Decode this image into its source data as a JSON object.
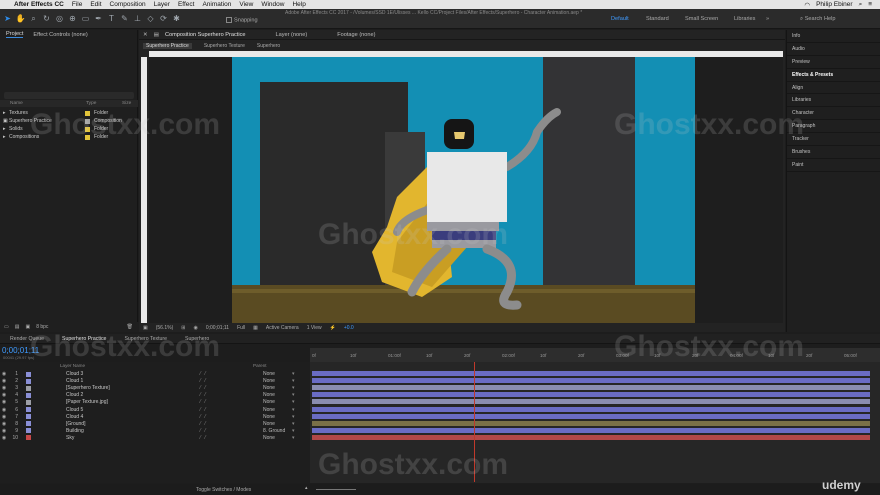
{
  "menubar": {
    "app": "After Effects CC",
    "items": [
      "File",
      "Edit",
      "Composition",
      "Layer",
      "Effect",
      "Animation",
      "View",
      "Window",
      "Help"
    ],
    "user": "Philip Ebiner"
  },
  "toolbar": {
    "title": "Adobe After Effects CC 2017 - /Volumes/SSD 1E/Ulisses ... Kello CC/Project Files/After Effects/Superhero - Character Animation.aep *",
    "snapping_label": "Snapping",
    "workspaces": [
      "Default",
      "Standard",
      "Small Screen",
      "Libraries"
    ],
    "active_workspace": "Default",
    "search_placeholder": "Search Help"
  },
  "project": {
    "tabs": [
      "Project",
      "Effect Controls (none)"
    ],
    "columns": [
      "Name",
      "Type",
      "Size"
    ],
    "items": [
      {
        "name": "Textures",
        "type": "Folder"
      },
      {
        "name": "Superhero Practice",
        "type": "Composition"
      },
      {
        "name": "Solids",
        "type": "Folder"
      },
      {
        "name": "Compositions",
        "type": "Folder"
      }
    ],
    "bpc": "8 bpc"
  },
  "comp": {
    "tabs": [
      "Composition Superhero Practice",
      "Layer (none)",
      "Footage (none)"
    ],
    "subtabs": [
      "Superhero Practice",
      "Superhero Texture",
      "Superhero"
    ],
    "footer": {
      "zoom": "(56.1%)",
      "timecode": "0;00;01;11",
      "resolution": "Full",
      "camera": "Active Camera",
      "views": "1 View",
      "exposure": "+0.0"
    },
    "colors": {
      "sky": "#138fb4",
      "building": "#2b2b2b",
      "ground": "#5a4b22",
      "cape": "#e2b62e",
      "shirt": "#e8e8e8",
      "stripe": "#3a3d7d",
      "limb": "#8c8c8c"
    }
  },
  "right_panels": [
    "Info",
    "Audio",
    "Preview",
    "Effects & Presets",
    "Align",
    "Libraries",
    "Character",
    "Paragraph",
    "Tracker",
    "Brushes",
    "Paint"
  ],
  "timeline": {
    "render_queue": "Render Queue",
    "tabs": [
      "Superhero Practice",
      "Superhero Texture",
      "Superhero"
    ],
    "timecode": "0;00;01;11",
    "fps": "00041 (29.97 fps)",
    "columns": {
      "name": "Layer Name",
      "parent": "Parent"
    },
    "layers": [
      {
        "num": "1",
        "name": "Cloud 3",
        "parent": "None",
        "color": "#8a8fd6"
      },
      {
        "num": "2",
        "name": "Cloud 1",
        "parent": "None",
        "color": "#8a8fd6"
      },
      {
        "num": "3",
        "name": "[Superhero Texture]",
        "parent": "None",
        "color": "#9c9ea6"
      },
      {
        "num": "4",
        "name": "Cloud 2",
        "parent": "None",
        "color": "#8a8fd6"
      },
      {
        "num": "5",
        "name": "[Paper Texture.jpg]",
        "parent": "None",
        "color": "#9c9ea6"
      },
      {
        "num": "6",
        "name": "Cloud 5",
        "parent": "None",
        "color": "#8a8fd6"
      },
      {
        "num": "7",
        "name": "Cloud 4",
        "parent": "None",
        "color": "#8a8fd6"
      },
      {
        "num": "8",
        "name": "[Ground]",
        "parent": "None",
        "color": "#8a8fd6"
      },
      {
        "num": "9",
        "name": "Building",
        "parent": "8. Ground",
        "color": "#8a8fd6"
      },
      {
        "num": "10",
        "name": "Sky",
        "parent": "None",
        "color": "#c74848"
      }
    ],
    "ruler_ticks": [
      "0f",
      "10f",
      "01:00f",
      "10f",
      "20f",
      "02:00f",
      "10f",
      "20f",
      "03:00f",
      "10f",
      "20f",
      "04:00f",
      "10f",
      "20f",
      "05:00f"
    ],
    "bar_colors": [
      "#6a6cc4",
      "#6a6cc4",
      "#8a8db0",
      "#6a6cc4",
      "#8a8db0",
      "#6a6cc4",
      "#6a6cc4",
      "#7a7048",
      "#6a6cc4",
      "#b24848"
    ],
    "footer": "Toggle Switches / Modes"
  },
  "watermark": "Ghostxx.com",
  "brand": "udemy"
}
